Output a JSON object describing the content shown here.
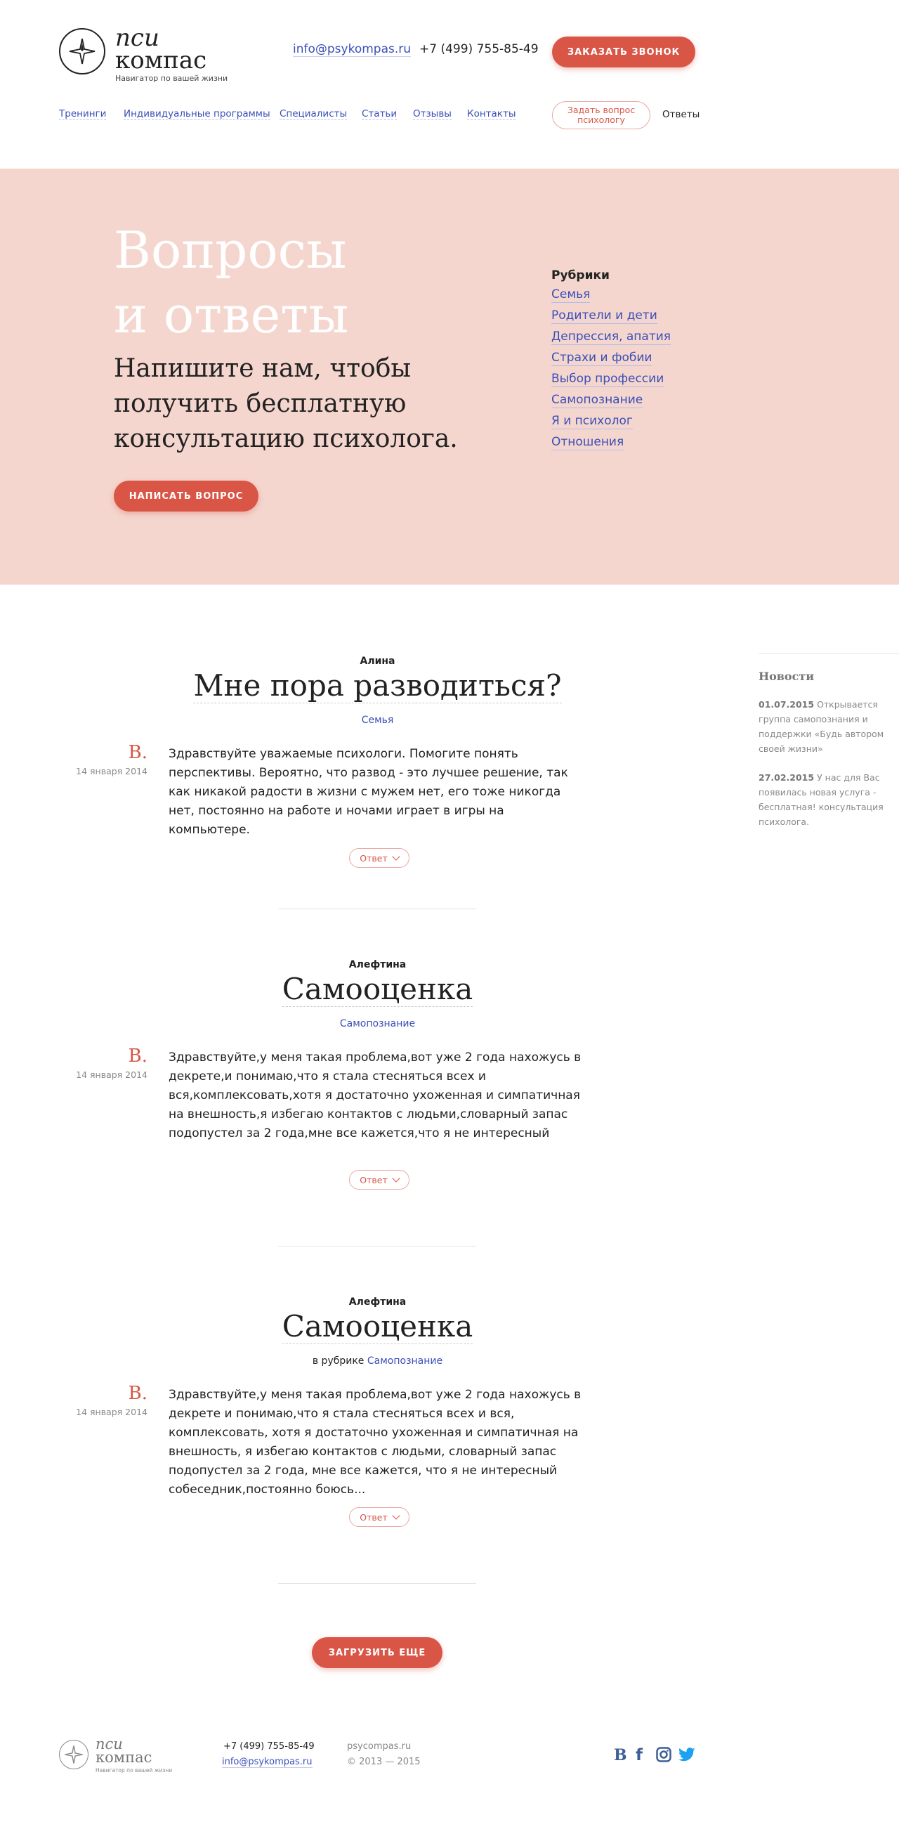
{
  "header": {
    "logo_word1": "пси",
    "logo_word2": "компас",
    "logo_tagline": "Навигатор по вашей жизни",
    "email": "info@psykompas.ru",
    "phone": "+7 (499) 755-85-49",
    "call_button": "ЗАКАЗАТЬ ЗВОНОК"
  },
  "nav": {
    "items": [
      "Тренинги",
      "Индивидуальные программы",
      "Специалисты",
      "Статьи",
      "Отзывы",
      "Контакты"
    ],
    "ask_button": "Задать вопрос психологу",
    "current": "Ответы"
  },
  "hero": {
    "title_line1": "Вопросы",
    "title_line2": "и ответы",
    "subtitle": "Напишите нам, чтобы получить бесплатную консультацию психолога.",
    "write_button": "НАПИСАТЬ ВОПРОС"
  },
  "rubrics": {
    "title": "Рубрики",
    "items": [
      "Семья",
      "Родители и дети",
      "Депрессия, апатия",
      "Страхи и фобии",
      "Выбор профессии",
      "Самопознание",
      "Я и психолог",
      "Отношения"
    ]
  },
  "questions": [
    {
      "author": "Алина",
      "title": "Мне пора разводиться?",
      "category_prefix": "",
      "category": "Семья",
      "initial": "В.",
      "date": "14 января 2014",
      "text": "Здравствуйте уважаемые психологи. Помогите понять перспективы. Вероятно, что развод - это лучшее решение, так как никакой радости в жизни с мужем нет, его тоже никогда нет, постоянно на работе и ночами играет в игры на компьютере.",
      "answer_button": "Ответ"
    },
    {
      "author": "Алефтина",
      "title": "Самооценка",
      "category_prefix": "",
      "category": "Самопознание",
      "initial": "В.",
      "date": "14 января 2014",
      "text": "Здравствуйте,у меня такая проблема,вот уже 2 года нахожусь в декрете,и понимаю,что я стала стесняться всех и вся,комплексовать,хотя я достаточно ухоженная и симпатичная на внешность,я избегаю контактов с людьми,словарный запас подопустел за 2 года,мне все кажется,что я не интересный",
      "answer_button": "Ответ"
    },
    {
      "author": "Алефтина",
      "title": "Самооценка",
      "category_prefix": "в рубрике ",
      "category": "Самопознание",
      "initial": "В.",
      "date": "14 января 2014",
      "text": "Здравствуйте,у меня такая проблема,вот уже 2 года нахожусь в декрете и понимаю,что я стала стесняться всех и вся, комплексовать, хотя я достаточно ухоженная и симпатичная на внешность, я избегаю контактов с людьми, словарный запас подопустел за 2 года, мне все кажется, что я не интересный собеседник,постоянно боюсь...",
      "answer_button": "Ответ"
    }
  ],
  "news": {
    "title": "Новости",
    "items": [
      {
        "date": "01.07.2015",
        "text": "Открывается группа самопознания и поддержки «Будь автором своей жизни»"
      },
      {
        "date": "27.02.2015",
        "text": "У нас для Вас появилась новая услуга - бесплатная! консультация психолога."
      }
    ]
  },
  "load_more": "ЗАГРУЗИТЬ ЕЩЕ",
  "footer": {
    "logo_word1": "пси",
    "logo_word2": "компас",
    "logo_tagline": "Навигатор по вашей жизни",
    "phone": "+7 (499) 755-85-49",
    "email": "info@psykompas.ru",
    "site": "psycompas.ru",
    "copyright": "© 2013 — 2015",
    "social": [
      "vk-icon",
      "facebook-icon",
      "instagram-icon",
      "twitter-icon"
    ]
  },
  "colors": {
    "accent": "#d95546",
    "link": "#3a4fb8",
    "hero_bg": "#f4d6ce",
    "social": "#3e5f95",
    "twitter": "#1da1f2"
  }
}
